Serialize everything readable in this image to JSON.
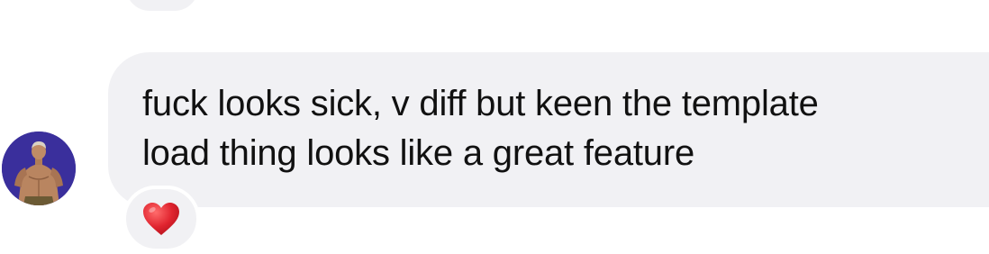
{
  "message": {
    "text_line_1": "fuck looks sick, v diff but keen the template",
    "text_line_2": "load thing looks like a great feature",
    "bubble_color": "#f1f1f4",
    "text_color": "#111111"
  },
  "sender": {
    "avatar_icon": "person-photo-avatar",
    "avatar_bg": "#3a2f9c"
  },
  "reaction": {
    "emoji": "❤️",
    "icon": "heart-icon",
    "color": "#e0242f"
  }
}
